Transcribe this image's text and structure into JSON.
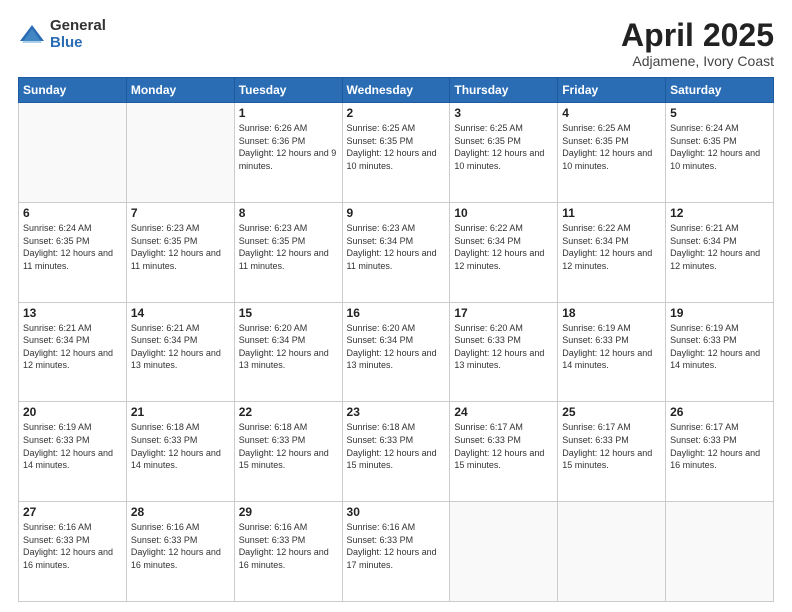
{
  "logo": {
    "general": "General",
    "blue": "Blue"
  },
  "title": {
    "month_year": "April 2025",
    "location": "Adjamene, Ivory Coast"
  },
  "days_of_week": [
    "Sunday",
    "Monday",
    "Tuesday",
    "Wednesday",
    "Thursday",
    "Friday",
    "Saturday"
  ],
  "weeks": [
    [
      {
        "day": null,
        "info": null
      },
      {
        "day": null,
        "info": null
      },
      {
        "day": "1",
        "info": "Sunrise: 6:26 AM\nSunset: 6:36 PM\nDaylight: 12 hours and 9 minutes."
      },
      {
        "day": "2",
        "info": "Sunrise: 6:25 AM\nSunset: 6:35 PM\nDaylight: 12 hours and 10 minutes."
      },
      {
        "day": "3",
        "info": "Sunrise: 6:25 AM\nSunset: 6:35 PM\nDaylight: 12 hours and 10 minutes."
      },
      {
        "day": "4",
        "info": "Sunrise: 6:25 AM\nSunset: 6:35 PM\nDaylight: 12 hours and 10 minutes."
      },
      {
        "day": "5",
        "info": "Sunrise: 6:24 AM\nSunset: 6:35 PM\nDaylight: 12 hours and 10 minutes."
      }
    ],
    [
      {
        "day": "6",
        "info": "Sunrise: 6:24 AM\nSunset: 6:35 PM\nDaylight: 12 hours and 11 minutes."
      },
      {
        "day": "7",
        "info": "Sunrise: 6:23 AM\nSunset: 6:35 PM\nDaylight: 12 hours and 11 minutes."
      },
      {
        "day": "8",
        "info": "Sunrise: 6:23 AM\nSunset: 6:35 PM\nDaylight: 12 hours and 11 minutes."
      },
      {
        "day": "9",
        "info": "Sunrise: 6:23 AM\nSunset: 6:34 PM\nDaylight: 12 hours and 11 minutes."
      },
      {
        "day": "10",
        "info": "Sunrise: 6:22 AM\nSunset: 6:34 PM\nDaylight: 12 hours and 12 minutes."
      },
      {
        "day": "11",
        "info": "Sunrise: 6:22 AM\nSunset: 6:34 PM\nDaylight: 12 hours and 12 minutes."
      },
      {
        "day": "12",
        "info": "Sunrise: 6:21 AM\nSunset: 6:34 PM\nDaylight: 12 hours and 12 minutes."
      }
    ],
    [
      {
        "day": "13",
        "info": "Sunrise: 6:21 AM\nSunset: 6:34 PM\nDaylight: 12 hours and 12 minutes."
      },
      {
        "day": "14",
        "info": "Sunrise: 6:21 AM\nSunset: 6:34 PM\nDaylight: 12 hours and 13 minutes."
      },
      {
        "day": "15",
        "info": "Sunrise: 6:20 AM\nSunset: 6:34 PM\nDaylight: 12 hours and 13 minutes."
      },
      {
        "day": "16",
        "info": "Sunrise: 6:20 AM\nSunset: 6:34 PM\nDaylight: 12 hours and 13 minutes."
      },
      {
        "day": "17",
        "info": "Sunrise: 6:20 AM\nSunset: 6:33 PM\nDaylight: 12 hours and 13 minutes."
      },
      {
        "day": "18",
        "info": "Sunrise: 6:19 AM\nSunset: 6:33 PM\nDaylight: 12 hours and 14 minutes."
      },
      {
        "day": "19",
        "info": "Sunrise: 6:19 AM\nSunset: 6:33 PM\nDaylight: 12 hours and 14 minutes."
      }
    ],
    [
      {
        "day": "20",
        "info": "Sunrise: 6:19 AM\nSunset: 6:33 PM\nDaylight: 12 hours and 14 minutes."
      },
      {
        "day": "21",
        "info": "Sunrise: 6:18 AM\nSunset: 6:33 PM\nDaylight: 12 hours and 14 minutes."
      },
      {
        "day": "22",
        "info": "Sunrise: 6:18 AM\nSunset: 6:33 PM\nDaylight: 12 hours and 15 minutes."
      },
      {
        "day": "23",
        "info": "Sunrise: 6:18 AM\nSunset: 6:33 PM\nDaylight: 12 hours and 15 minutes."
      },
      {
        "day": "24",
        "info": "Sunrise: 6:17 AM\nSunset: 6:33 PM\nDaylight: 12 hours and 15 minutes."
      },
      {
        "day": "25",
        "info": "Sunrise: 6:17 AM\nSunset: 6:33 PM\nDaylight: 12 hours and 15 minutes."
      },
      {
        "day": "26",
        "info": "Sunrise: 6:17 AM\nSunset: 6:33 PM\nDaylight: 12 hours and 16 minutes."
      }
    ],
    [
      {
        "day": "27",
        "info": "Sunrise: 6:16 AM\nSunset: 6:33 PM\nDaylight: 12 hours and 16 minutes."
      },
      {
        "day": "28",
        "info": "Sunrise: 6:16 AM\nSunset: 6:33 PM\nDaylight: 12 hours and 16 minutes."
      },
      {
        "day": "29",
        "info": "Sunrise: 6:16 AM\nSunset: 6:33 PM\nDaylight: 12 hours and 16 minutes."
      },
      {
        "day": "30",
        "info": "Sunrise: 6:16 AM\nSunset: 6:33 PM\nDaylight: 12 hours and 17 minutes."
      },
      {
        "day": null,
        "info": null
      },
      {
        "day": null,
        "info": null
      },
      {
        "day": null,
        "info": null
      }
    ]
  ]
}
